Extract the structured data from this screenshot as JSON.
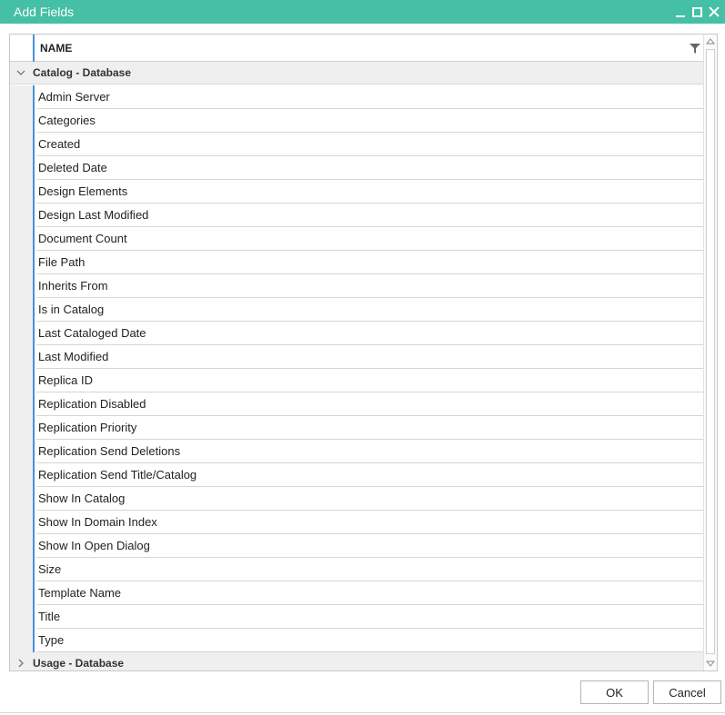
{
  "window": {
    "title": "Add Fields"
  },
  "grid": {
    "column_header": "NAME",
    "groups": [
      {
        "label": "Catalog - Database",
        "expanded": true,
        "items": [
          "Admin Server",
          "Categories",
          "Created",
          "Deleted Date",
          "Design Elements",
          "Design Last Modified",
          "Document Count",
          "File Path",
          "Inherits From",
          "Is in Catalog",
          "Last Cataloged Date",
          "Last Modified",
          "Replica ID",
          "Replication Disabled",
          "Replication Priority",
          "Replication Send Deletions",
          "Replication Send Title/Catalog",
          "Show In Catalog",
          "Show In Domain Index",
          "Show In Open Dialog",
          "Size",
          "Template Name",
          "Title",
          "Type"
        ]
      },
      {
        "label": "Usage - Database",
        "expanded": false
      }
    ]
  },
  "buttons": {
    "ok": "OK",
    "cancel": "Cancel"
  },
  "colors": {
    "titlebar": "#45bfa5",
    "accent_line": "#4a90d9"
  }
}
